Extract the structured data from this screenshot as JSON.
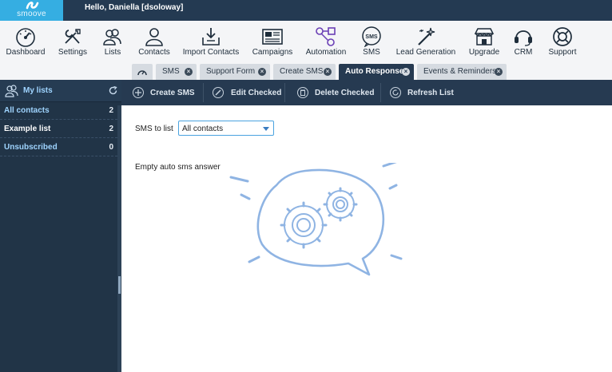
{
  "header": {
    "logo_text": "smoove",
    "greeting": "Hello, Daniella [dsoloway]"
  },
  "toolbar": {
    "items": [
      {
        "label": "Dashboard",
        "icon": "gauge-icon"
      },
      {
        "label": "Settings",
        "icon": "tools-icon"
      },
      {
        "label": "Lists",
        "icon": "people-icon"
      },
      {
        "label": "Contacts",
        "icon": "person-icon"
      },
      {
        "label": "Import Contacts",
        "icon": "import-icon"
      },
      {
        "label": "Campaigns",
        "icon": "newspaper-icon"
      },
      {
        "label": "Automation",
        "icon": "flow-icon"
      },
      {
        "label": "SMS",
        "icon": "sms-icon"
      },
      {
        "label": "Lead Generation",
        "icon": "magic-wand-icon"
      },
      {
        "label": "Upgrade",
        "icon": "store-icon"
      },
      {
        "label": "CRM",
        "icon": "headset-icon"
      },
      {
        "label": "Support",
        "icon": "lifebuoy-icon"
      }
    ]
  },
  "tabs": {
    "items": [
      {
        "label": "SMS"
      },
      {
        "label": "Support Form"
      },
      {
        "label": "Create SMS"
      },
      {
        "label": "Auto Response"
      },
      {
        "label": "Events & Reminders"
      }
    ],
    "active_index": 3
  },
  "sidebar": {
    "title": "My lists",
    "items": [
      {
        "name": "All contacts",
        "count": "2"
      },
      {
        "name": "Example list",
        "count": "2"
      },
      {
        "name": "Unsubscribed",
        "count": "0"
      }
    ]
  },
  "actions": {
    "create": "Create SMS",
    "edit": "Edit Checked",
    "delete": "Delete Checked",
    "refresh": "Refresh List"
  },
  "main": {
    "sms_to_list_label": "SMS to list",
    "selected_list": "All contacts",
    "empty_message": "Empty auto sms answer"
  },
  "colors": {
    "top_bar": "#243a52",
    "brand": "#35aee2",
    "sidebar": "#213447",
    "action_bar": "#263a51",
    "illustration": "#8fb4e3",
    "link_blue": "#9fd4ff"
  }
}
